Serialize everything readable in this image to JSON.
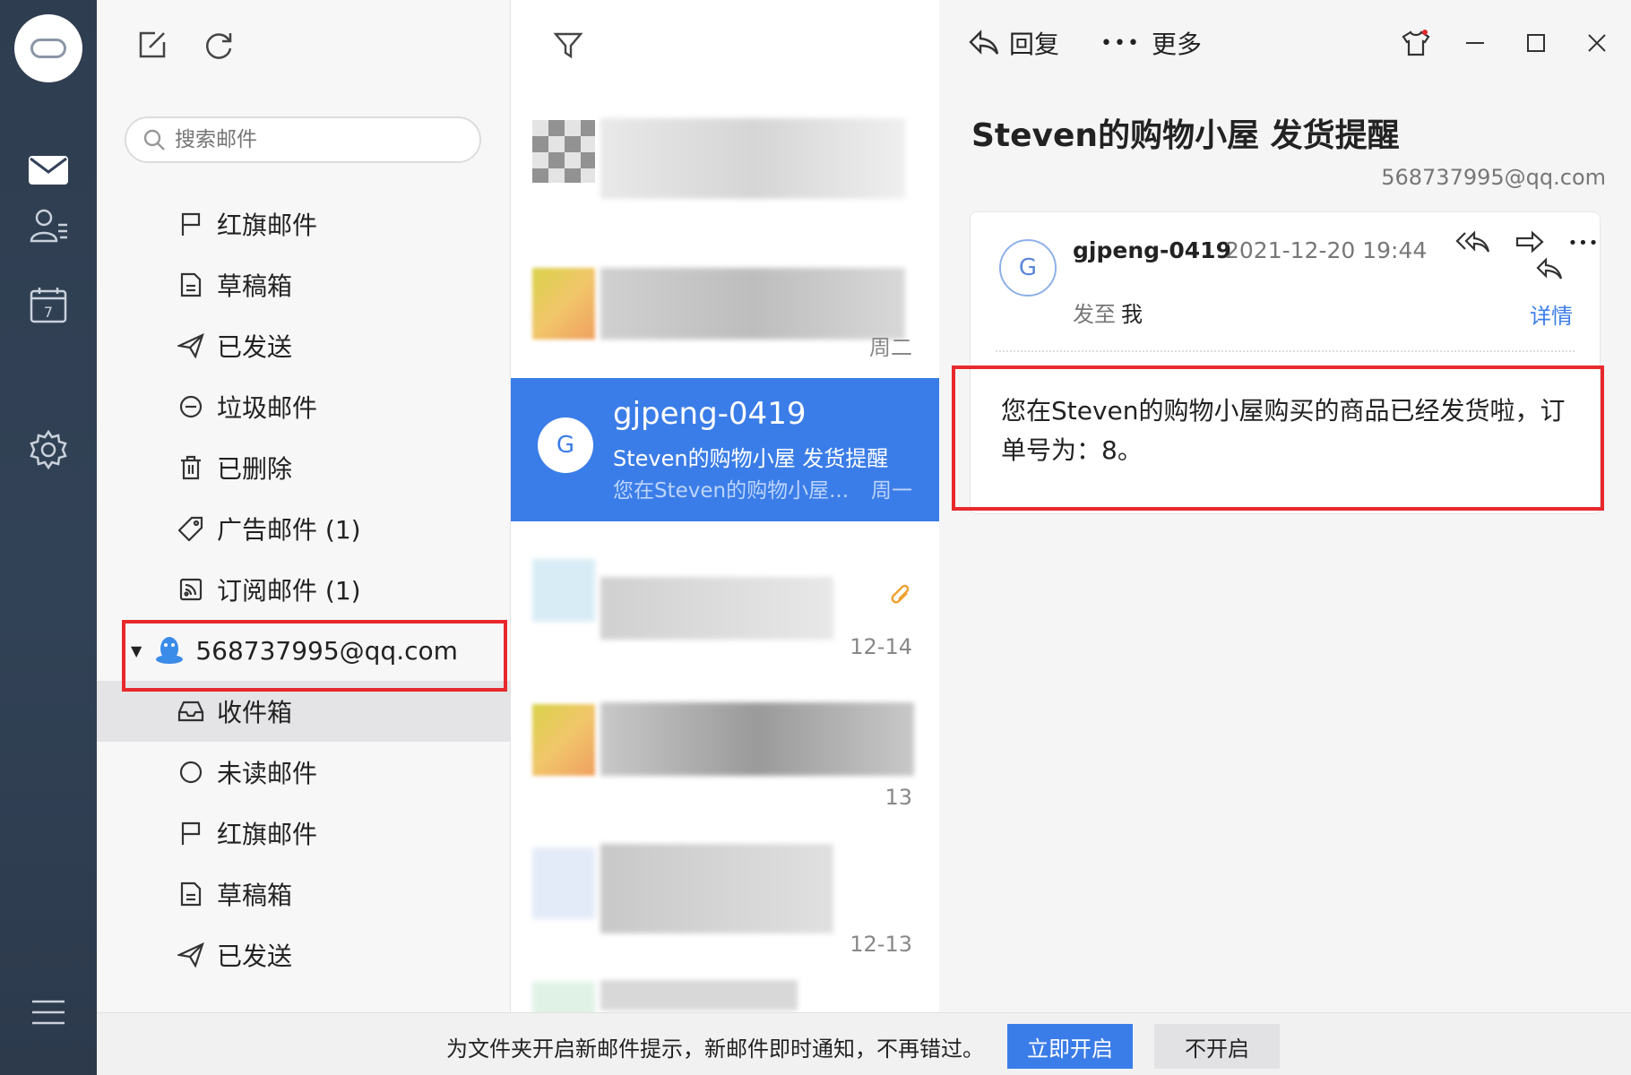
{
  "app": {
    "accent_color": "#3b7de8",
    "annotation_color": "#e8292c"
  },
  "rail": {
    "items": [
      {
        "name": "mail-icon"
      },
      {
        "name": "contacts-icon"
      },
      {
        "name": "calendar-icon",
        "day": "7"
      },
      {
        "name": "settings-icon"
      },
      {
        "name": "menu-icon"
      }
    ]
  },
  "folders": {
    "search_placeholder": "搜索邮件",
    "toolbar": [
      "compose-icon",
      "refresh-icon"
    ],
    "top_items": [
      {
        "label": "红旗邮件",
        "icon": "flag-icon"
      },
      {
        "label": "草稿箱",
        "icon": "draft-icon"
      },
      {
        "label": "已发送",
        "icon": "sent-icon"
      },
      {
        "label": "垃圾邮件",
        "icon": "spam-icon"
      },
      {
        "label": "已删除",
        "icon": "trash-icon"
      },
      {
        "label": "广告邮件 (1)",
        "icon": "tag-icon"
      },
      {
        "label": "订阅邮件 (1)",
        "icon": "rss-icon"
      }
    ],
    "account": "568737995@qq.com",
    "account_items": [
      {
        "label": "收件箱",
        "icon": "inbox-icon"
      },
      {
        "label": "未读邮件",
        "icon": "unread-icon"
      },
      {
        "label": "红旗邮件",
        "icon": "flag-icon"
      },
      {
        "label": "草稿箱",
        "icon": "draft-icon"
      },
      {
        "label": "已发送",
        "icon": "sent-icon"
      }
    ]
  },
  "list": {
    "dates": [
      "周二",
      "12-14",
      "13",
      "12-13"
    ],
    "selected": {
      "avatar": "G",
      "sender": "gjpeng-0419",
      "subject": "Steven的购物小屋 发货提醒",
      "preview": "您在Steven的购物小屋...",
      "date": "周一"
    }
  },
  "reader": {
    "reply_label": "回复",
    "more_label": "更多",
    "title": "Steven的购物小屋 发货提醒",
    "account": "568737995@qq.com",
    "avatar": "G",
    "from": "gjpeng-0419",
    "time": "2021-12-20 19:44",
    "to_label": "发至",
    "to_value": "我",
    "details_label": "详情",
    "body": "您在Steven的购物小屋购买的商品已经发货啦，订单号为：8。"
  },
  "notice": {
    "text": "为文件夹开启新邮件提示，新邮件即时通知，不再错过。",
    "enable_label": "立即开启",
    "disable_label": "不开启"
  }
}
